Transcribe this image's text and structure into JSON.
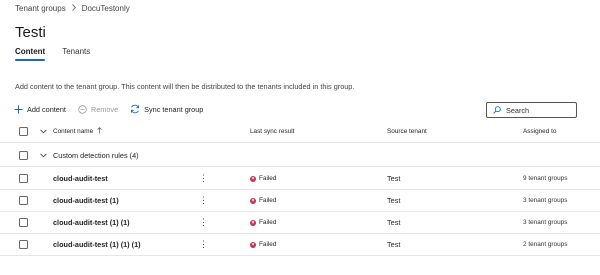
{
  "breadcrumb": {
    "parent": "Tenant groups",
    "current": "DocuTestonly"
  },
  "page": {
    "title": "Testi"
  },
  "tabs": [
    {
      "label": "Content"
    },
    {
      "label": "Tenants"
    }
  ],
  "description": "Add content to the tenant group. This content will then be distributed to the tenants included in this group.",
  "toolbar": {
    "add_label": "Add content",
    "remove_label": "Remove",
    "sync_label": "Sync tenant group"
  },
  "search": {
    "placeholder": "Search"
  },
  "table": {
    "headers": {
      "name": "Content name",
      "sync": "Last sync result",
      "source": "Source tenant",
      "assigned": "Assigned to"
    },
    "group": {
      "label": "Custom detection rules (4)"
    },
    "rows": [
      {
        "name": "cloud-audit-test",
        "status": "Failed",
        "source": "Test",
        "assigned": "9 tenant groups"
      },
      {
        "name": "cloud-audit-test (1)",
        "status": "Failed",
        "source": "Test",
        "assigned": "3 tenant groups"
      },
      {
        "name": "cloud-audit-test (1) (1)",
        "status": "Failed",
        "source": "Test",
        "assigned": "3 tenant groups"
      },
      {
        "name": "cloud-audit-test (1) (1) (1)",
        "status": "Failed",
        "source": "Test",
        "assigned": "2 tenant groups"
      }
    ]
  },
  "colors": {
    "accent": "#0f6cbd",
    "failed": "#c4314b"
  }
}
